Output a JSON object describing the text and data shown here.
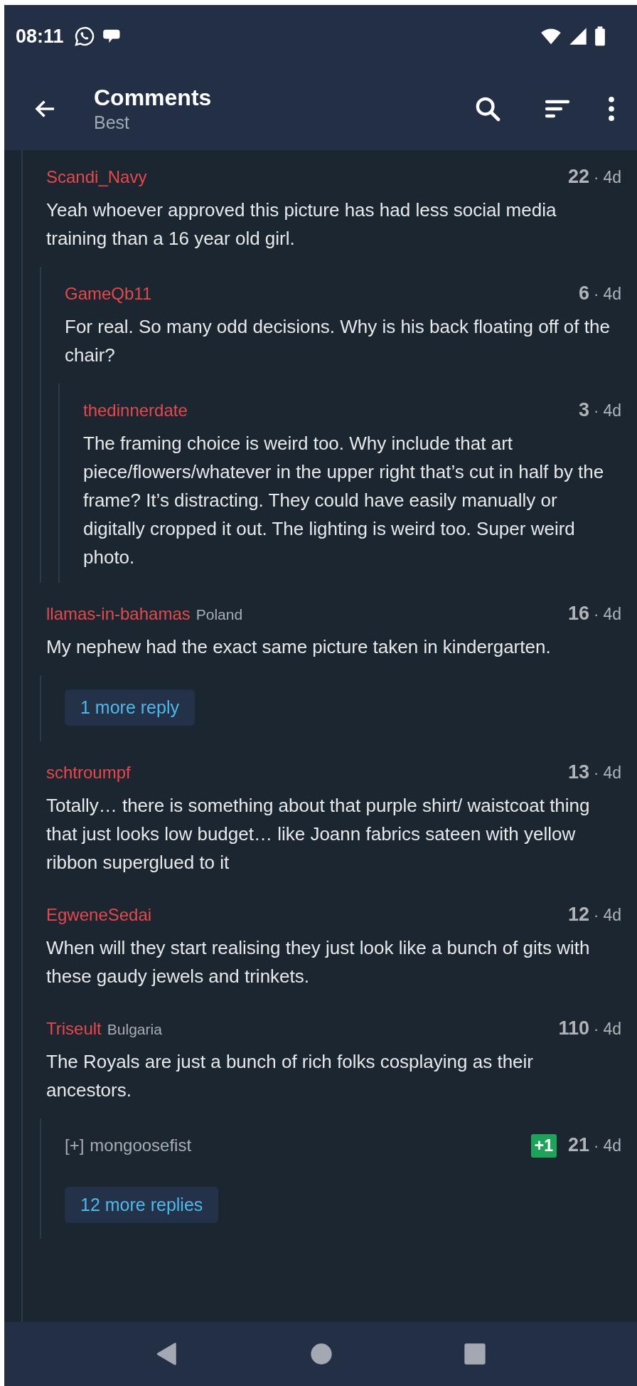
{
  "status_bar": {
    "time": "08:11"
  },
  "header": {
    "title": "Comments",
    "subtitle": "Best"
  },
  "comments": [
    {
      "kind": "comment",
      "author": "Scandi_Navy",
      "score": "22",
      "dot": "·",
      "age": "4d",
      "body": "Yeah whoever approved this picture has had less social media training than a 16 year old girl.",
      "collapsed": false,
      "children": [
        {
          "kind": "comment",
          "author": "GameQb11",
          "score": "6",
          "dot": "·",
          "age": "4d",
          "body": "For real. So many odd decisions. Why is his back floating off of the chair?",
          "collapsed": false,
          "children": [
            {
              "kind": "comment",
              "author": "thedinnerdate",
              "score": "3",
              "dot": "·",
              "age": "4d",
              "body": "The framing choice is weird too. Why include that art piece/flowers/whatever in the upper right that’s cut in half by the frame? It’s distracting. They could have easily manually or digitally cropped it out. The lighting is weird too. Super weird photo.",
              "collapsed": false
            }
          ]
        }
      ]
    },
    {
      "kind": "comment",
      "author": "llamas-in-bahamas",
      "flair": "Poland",
      "score": "16",
      "dot": "·",
      "age": "4d",
      "body": "My nephew had the exact same picture taken in kindergarten.",
      "collapsed": false,
      "children": [
        {
          "kind": "more",
          "label": "1 more reply"
        }
      ]
    },
    {
      "kind": "comment",
      "author": "schtroumpf",
      "score": "13",
      "dot": "·",
      "age": "4d",
      "body": "Totally… there is something about that purple shirt/ waistcoat thing that just looks low budget… like Joann fabrics sateen with yellow ribbon superglued to it",
      "collapsed": false
    },
    {
      "kind": "comment",
      "author": "EgweneSedai",
      "score": "12",
      "dot": "·",
      "age": "4d",
      "body": "When will they start realising they just look like a bunch of gits with these gaudy jewels and trinkets.",
      "collapsed": false
    },
    {
      "kind": "comment",
      "author": "Triseult",
      "flair": "Bulgaria",
      "score": "110",
      "dot": "·",
      "age": "4d",
      "body": "The Royals are just a bunch of rich folks cosplaying as their ancestors.",
      "collapsed": false,
      "children": [
        {
          "kind": "comment",
          "toggle": "[+]",
          "author": "mongoosefist",
          "badge": "+1",
          "score": "21",
          "dot": "·",
          "age": "4d",
          "collapsed": true
        },
        {
          "kind": "more",
          "label": "12 more replies"
        }
      ]
    }
  ]
}
